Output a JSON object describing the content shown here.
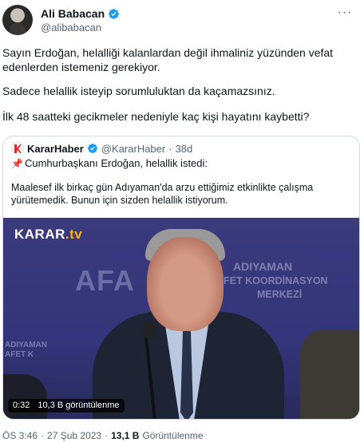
{
  "author": {
    "name": "Ali Babacan",
    "handle": "@alibabacan",
    "more_glyph": "···"
  },
  "tweet_text": {
    "p1": "Sayın Erdoğan, helalliği kalanlardan değil ihmaliniz yüzünden vefat edenlerden istemeniz gerekiyor.",
    "p2": "Sadece helallik isteyip sorumluluktan da kaçamazsınız.",
    "p3": "İlk 48 saatteki gecikmeler nedeniyle kaç kişi hayatını kaybetti?"
  },
  "quoted": {
    "name": "KararHaber",
    "handle": "@KararHaber",
    "separator": "·",
    "age": "38d",
    "pin_glyph": "📌",
    "line1": "Cumhurbaşkanı Erdoğan, helallik istedi:",
    "text": "Maalesef ilk birkaç gün Adıyaman'da arzu ettiğimiz etkinlikte çalışma yürütemedik. Bunun için sizden helallik istiyorum.",
    "video": {
      "brand_main": "KARAR",
      "brand_suffix": ".tv",
      "bg_afa": "AFA",
      "bg_adiyaman": "ADIYAMAN",
      "bg_afet": "AFET KOORDİNASYON",
      "bg_merkezi": "MERKEZİ",
      "bg_left": "ADIYAMAN\nAFET K",
      "duration": "0:32",
      "views": "10,3 B görüntülenme"
    }
  },
  "footer": {
    "time": "ÖS 3:46",
    "separator": "·",
    "date": "27 Şub 2023",
    "separator2": "·",
    "views_count": "13,1 B",
    "views_label": "Görüntülenme"
  },
  "colors": {
    "verified_blue": "#1d9bf0",
    "secondary_text": "#536471",
    "karar_red": "#e3262b"
  },
  "icons": {
    "verified": "verified-badge-icon",
    "more": "more-horizontal-icon",
    "pin": "pushpin-icon"
  }
}
